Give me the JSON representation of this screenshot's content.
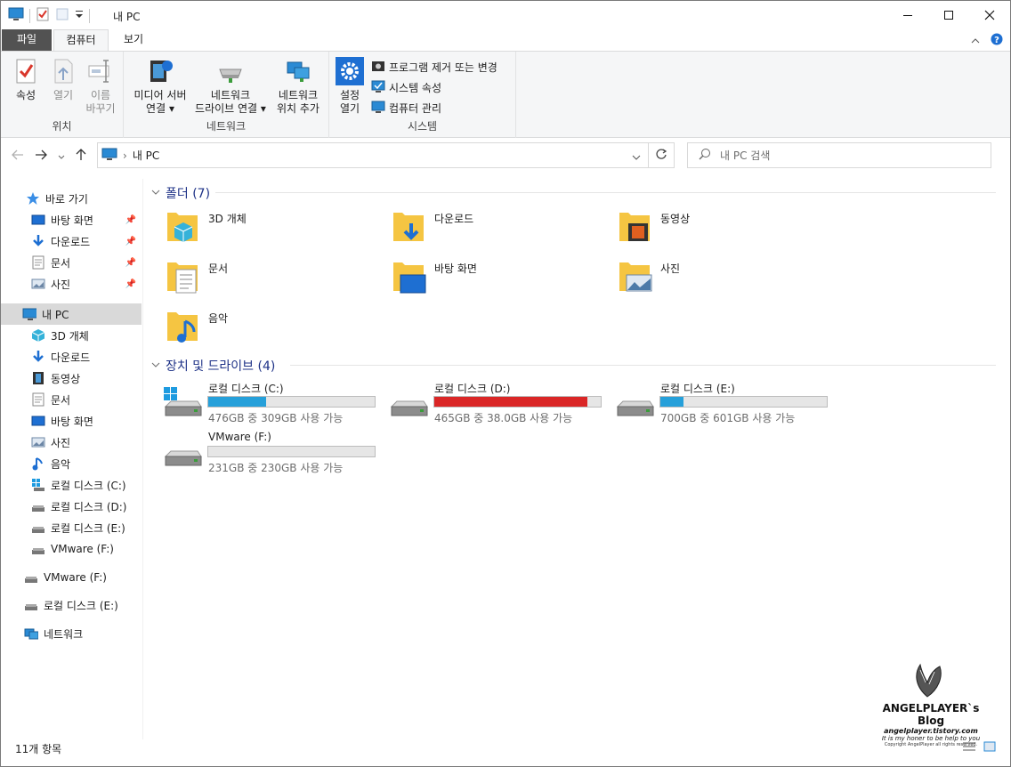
{
  "window": {
    "title": "내 PC"
  },
  "tabs": {
    "file": "파일",
    "computer": "컴퓨터",
    "view": "보기"
  },
  "ribbon": {
    "location": {
      "label": "위치",
      "properties": "속성",
      "open": "열기",
      "rename_1": "이름",
      "rename_2": "바꾸기"
    },
    "network": {
      "label": "네트워크",
      "media_1": "미디어 서버",
      "media_2": "연결",
      "map_1": "네트워크",
      "map_2": "드라이브 연결",
      "add_1": "네트워크",
      "add_2": "위치 추가"
    },
    "system": {
      "label": "시스템",
      "settings_1": "설정",
      "settings_2": "열기",
      "uninstall": "프로그램 제거 또는 변경",
      "sysprops": "시스템 속성",
      "manage": "컴퓨터 관리"
    }
  },
  "address": {
    "path": "내 PC",
    "search_placeholder": "내 PC 검색"
  },
  "nav": {
    "quick_access": "바로 가기",
    "quick": [
      "바탕 화면",
      "다운로드",
      "문서",
      "사진"
    ],
    "this_pc": "내 PC",
    "pc_items": [
      "3D 개체",
      "다운로드",
      "동영상",
      "문서",
      "바탕 화면",
      "사진",
      "음악",
      "로컬 디스크 (C:)",
      "로컬 디스크 (D:)",
      "로컬 디스크 (E:)",
      "VMware (F:)"
    ],
    "vmware": "VMware (F:)",
    "local_e": "로컬 디스크 (E:)",
    "network": "네트워크"
  },
  "folders": {
    "header": "폴더 (7)",
    "items": [
      "3D 개체",
      "다운로드",
      "동영상",
      "문서",
      "바탕 화면",
      "사진",
      "음악"
    ]
  },
  "drives": {
    "header": "장치 및 드라이브 (4)",
    "items": [
      {
        "name": "로컬 디스크 (C:)",
        "free": "476GB 중 309GB 사용 가능",
        "used_fraction": 0.35,
        "color": "#26a0da"
      },
      {
        "name": "로컬 디스크 (D:)",
        "free": "465GB 중 38.0GB 사용 가능",
        "used_fraction": 0.92,
        "color": "#da2626"
      },
      {
        "name": "로컬 디스크 (E:)",
        "free": "700GB 중 601GB 사용 가능",
        "used_fraction": 0.14,
        "color": "#26a0da"
      },
      {
        "name": "VMware (F:)",
        "free": "231GB 중 230GB 사용 가능",
        "used_fraction": 0.0,
        "color": "#26a0da"
      }
    ]
  },
  "status": {
    "count": "11개 항목"
  },
  "watermark": {
    "title": "ANGELPLAYER`s Blog",
    "url": "angelplayer.tistory.com",
    "tagline": "It is my honer to be help to you",
    "copyright": "Copyright AngelPlayer all rights reserved."
  }
}
